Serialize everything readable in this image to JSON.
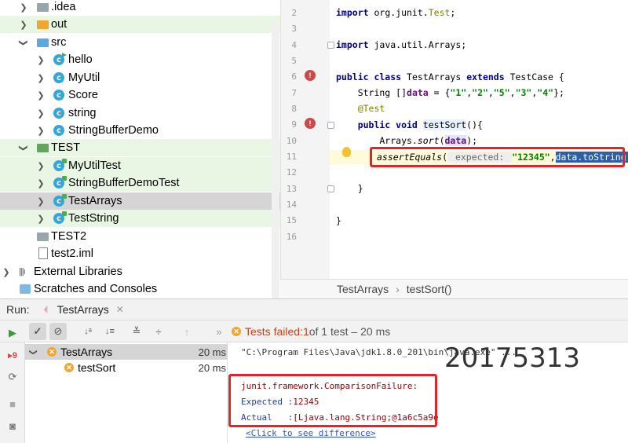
{
  "tree": {
    "items": [
      {
        "label": ".idea",
        "icon": "folder-gray"
      },
      {
        "label": "out",
        "icon": "folder-orange"
      },
      {
        "label": "src",
        "icon": "folder-blue"
      },
      {
        "label": "hello",
        "icon": "class-main"
      },
      {
        "label": "MyUtil",
        "icon": "class"
      },
      {
        "label": "Score",
        "icon": "class"
      },
      {
        "label": "string",
        "icon": "class"
      },
      {
        "label": "StringBufferDemo",
        "icon": "class"
      },
      {
        "label": "TEST",
        "icon": "folder-green"
      },
      {
        "label": "MyUtilTest",
        "icon": "class-test"
      },
      {
        "label": "StringBufferDemoTest",
        "icon": "class-test"
      },
      {
        "label": "TestArrays",
        "icon": "class-test"
      },
      {
        "label": "TestString",
        "icon": "class-test"
      },
      {
        "label": "TEST2",
        "icon": "folder-gray"
      },
      {
        "label": "test2.iml",
        "icon": "file"
      },
      {
        "label": "External Libraries",
        "icon": "library"
      },
      {
        "label": "Scratches and Consoles",
        "icon": "scratch"
      }
    ]
  },
  "editor": {
    "line_numbers": [
      "2",
      "3",
      "4",
      "5",
      "6",
      "7",
      "8",
      "9",
      "10",
      "11",
      "12",
      "13",
      "14",
      "15",
      "16"
    ],
    "code": {
      "l2a": "import ",
      "l2b": "org.junit.",
      "l2c": "Test",
      "l2d": ";",
      "l4a": "import ",
      "l4b": "java.util.Arrays;",
      "l6a": "public class ",
      "l6b": "TestArrays ",
      "l6c": "extends ",
      "l6d": "TestCase {",
      "l7a": "    String []",
      "l7b": "data",
      "l7c": " = {",
      "l7d": "\"1\"",
      "l7e": ",",
      "l7f": "\"2\"",
      "l7g": ",",
      "l7h": "\"5\"",
      "l7i": ",",
      "l7j": "\"3\"",
      "l7k": ",",
      "l7l": "\"4\"",
      "l7m": "};",
      "l8": "    @Test",
      "l9a": "    public void ",
      "l9b": "testSort",
      "l9c": "(){",
      "l10a": "        Arrays.",
      "l10b": "sort",
      "l10c": "(",
      "l10d": "data",
      "l10e": ");",
      "l11a": "assertEquals",
      "l11b": "(",
      "l11c": " expected: ",
      "l11d": "\"12345\"",
      "l11e": ",",
      "l11f": "data",
      "l11g": ".toString()",
      "l11h": ");",
      "l13": "    }",
      "l15": "}"
    },
    "breadcrumb": {
      "class": "TestArrays",
      "sep": "›",
      "method": "testSort()"
    }
  },
  "run": {
    "label": "Run:",
    "tab": "TestArrays",
    "status_prefix": "Tests failed: ",
    "status_count": "1",
    "status_rest": " of 1 test – 20 ms",
    "tests": [
      {
        "name": "TestArrays",
        "time": "20 ms"
      },
      {
        "name": "testSort",
        "time": "20 ms"
      }
    ],
    "console": {
      "cmd": "\"C:\\Program Files\\Java\\jdk1.8.0_201\\bin\\java.exe\" ...",
      "watermark": "20175313",
      "err1": "junit.framework.ComparisonFailure:",
      "exp_label": "Expected :",
      "exp_val": "12345",
      "act_label": "Actual   :",
      "act_val": "[Ljava.lang.String;@1a6c5a9e",
      "diff_link": "<Click to see difference>"
    }
  }
}
